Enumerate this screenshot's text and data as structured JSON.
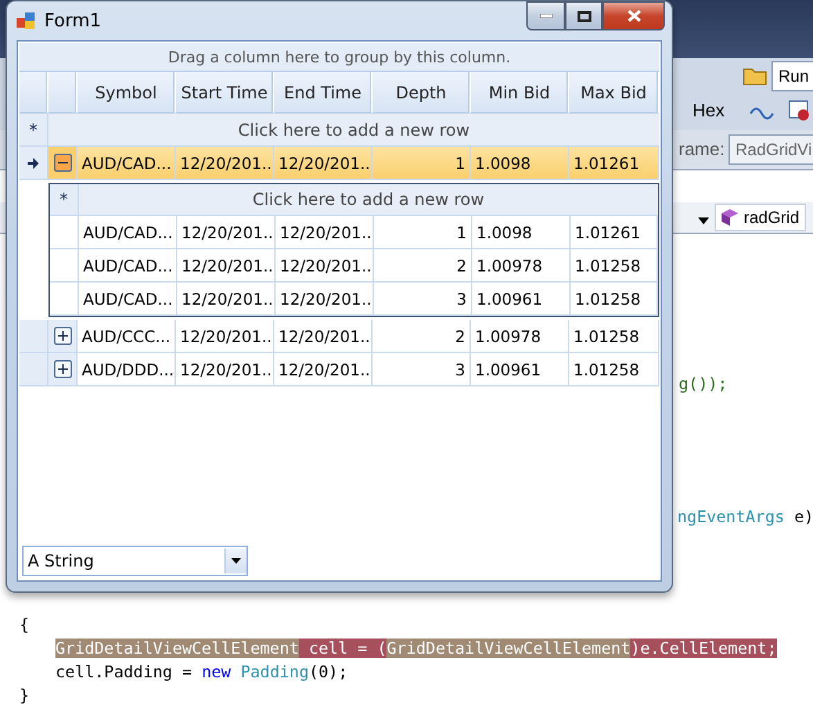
{
  "window": {
    "title": "Form1"
  },
  "grid": {
    "group_panel": "Drag a column here to group by this column.",
    "columns": [
      "Symbol",
      "Start Time",
      "End Time",
      "Depth",
      "Min Bid",
      "Max Bid"
    ],
    "new_row": {
      "marker": "*",
      "text": "Click here to add a new row"
    },
    "rows": [
      {
        "selected": true,
        "current": true,
        "expanded": true,
        "cells": [
          "AUD/CAD...",
          "12/20/201...",
          "12/20/201...",
          "1",
          "1.0098",
          "1.01261"
        ],
        "detail": {
          "new_row": {
            "marker": "*",
            "text": "Click here to add a new row"
          },
          "rows": [
            {
              "cells": [
                "AUD/CAD...",
                "12/20/201...",
                "12/20/201...",
                "1",
                "1.0098",
                "1.01261"
              ]
            },
            {
              "cells": [
                "AUD/CAD...",
                "12/20/201...",
                "12/20/201...",
                "2",
                "1.00978",
                "1.01258"
              ]
            },
            {
              "cells": [
                "AUD/CAD...",
                "12/20/201...",
                "12/20/201...",
                "3",
                "1.00961",
                "1.01258"
              ]
            }
          ]
        }
      },
      {
        "selected": false,
        "current": false,
        "expanded": false,
        "cells": [
          "AUD/CCC...",
          "12/20/201...",
          "12/20/201...",
          "2",
          "1.00978",
          "1.01258"
        ]
      },
      {
        "selected": false,
        "current": false,
        "expanded": false,
        "cells": [
          "AUD/DDD...",
          "12/20/201...",
          "12/20/201...",
          "3",
          "1.00961",
          "1.01258"
        ]
      }
    ]
  },
  "combobox": {
    "value": "A String"
  },
  "ide": {
    "run_field": "Run",
    "hex_button": "Hex",
    "frame_label": "rame:",
    "frame_field": "RadGridVi",
    "member_dropdown": "radGrid",
    "code": [
      {
        "tokens": [
          {
            "text": "g());",
            "kind": "method"
          }
        ]
      },
      {
        "tokens": [
          {
            "text": "ngEventArgs",
            "kind": "type"
          },
          {
            "text": " e)",
            "kind": "plain"
          }
        ]
      },
      {
        "tokens": [
          {
            "text": "{",
            "kind": "plain"
          }
        ]
      },
      {
        "tokens": [
          {
            "text": "GridDetailViewCellElement",
            "kind": "type-highlight"
          },
          {
            "text": " cell = (",
            "kind": "error-highlight"
          },
          {
            "text": "GridDetailViewCellElement",
            "kind": "type-highlight"
          },
          {
            "text": ")e.CellElement;",
            "kind": "error-highlight"
          }
        ]
      },
      {
        "tokens": [
          {
            "text": "cell.Padding = ",
            "kind": "plain"
          },
          {
            "text": "new",
            "kind": "keyword"
          },
          {
            "text": " Padding",
            "kind": "type"
          },
          {
            "text": "(0);",
            "kind": "plain"
          }
        ]
      },
      {
        "tokens": [
          {
            "text": "}",
            "kind": "plain"
          }
        ]
      }
    ]
  }
}
